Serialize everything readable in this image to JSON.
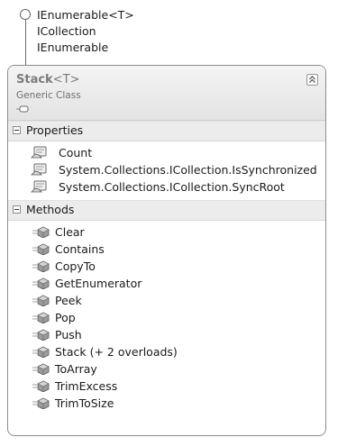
{
  "interfaces": [
    "IEnumerable<T>",
    "ICollection",
    "IEnumerable"
  ],
  "class": {
    "name": "Stack",
    "type_param": "<T>",
    "kind": "Generic Class"
  },
  "sections": {
    "properties": {
      "label": "Properties",
      "items": [
        "Count",
        "System.Collections.ICollection.IsSynchronized",
        "System.Collections.ICollection.SyncRoot"
      ]
    },
    "methods": {
      "label": "Methods",
      "items": [
        "Clear",
        "Contains",
        "CopyTo",
        "GetEnumerator",
        "Peek",
        "Pop",
        "Push",
        "Stack (+ 2 overloads)",
        "ToArray",
        "TrimExcess",
        "TrimToSize"
      ]
    }
  },
  "icons": {
    "interface": "lollipop-interface-icon",
    "class_glyph": "class-shortcut-icon",
    "collapse": "double-chevron-up-icon",
    "section_toggle": "minus-box-icon",
    "property": "property-hand-icon",
    "method": "method-cube-icon"
  },
  "colors": {
    "header_gradient_top": "#f4f4f4",
    "header_gradient_bottom": "#e3e3e3",
    "section_bg": "#ececec",
    "border": "#8c8c8c"
  }
}
